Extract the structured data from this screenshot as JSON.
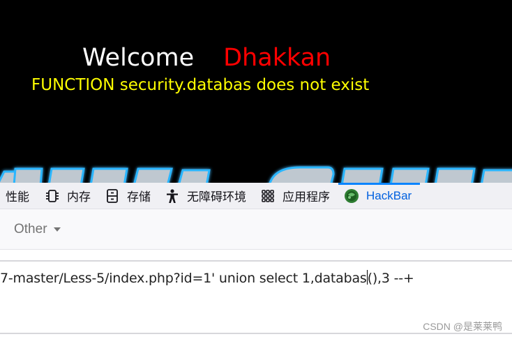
{
  "site": {
    "welcome_word": "Welcome",
    "welcome_name": "Dhakkan",
    "error_message": "FUNCTION security.databas does not exist",
    "colors": {
      "background": "#000000",
      "welcome": "#ffffff",
      "name": "#ff0000",
      "error": "#ffff00"
    }
  },
  "devtools": {
    "tabs": [
      {
        "label": "性能",
        "icon": ""
      },
      {
        "label": "内存",
        "icon": "memory-chip-icon"
      },
      {
        "label": "存储",
        "icon": "storage-icon"
      },
      {
        "label": "无障碍环境",
        "icon": "accessibility-icon"
      },
      {
        "label": "应用程序",
        "icon": "app-grid-icon"
      },
      {
        "label": "HackBar",
        "icon": "hackbar-logo-icon",
        "active": true
      }
    ],
    "active_color": "#0060df"
  },
  "hackbar": {
    "other_label": "Other",
    "url_before_caret": "7-master/Less-5/index.php?id=1' union select 1,databas",
    "url_after_caret": "(),3 --+"
  },
  "watermark": "CSDN @是莱莱鸭"
}
